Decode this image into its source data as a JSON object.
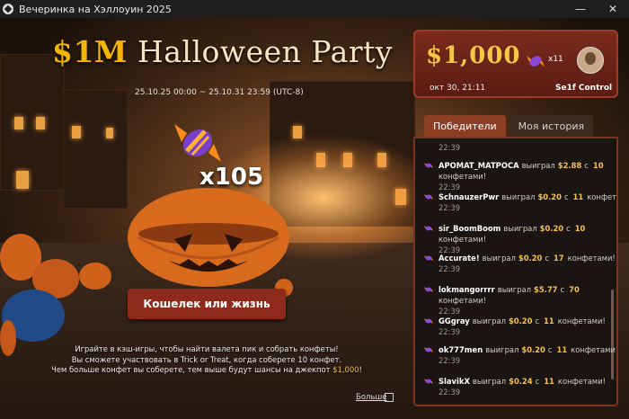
{
  "window": {
    "title": "Вечеринка на Хэллоуин 2025"
  },
  "promo": {
    "title_amount": "$1M",
    "title_text": "Halloween Party",
    "dates": "25.10.25 00:00 ~ 25.10.31 23:59 (UTC-8)",
    "candy_count": "x105",
    "cta_label": "Кошелек или жизнь",
    "desc_line1": "Играйте в кэш-игры, чтобы найти валета пик и собрать конфеты!",
    "desc_line2": "Вы сможете участвовать в Trick or Treat, когда соберете 10 конфет.",
    "desc_line3": "Чем больше конфет вы соберете, тем выше будут шансы на джекпот",
    "desc_jackpot": "$1,000",
    "desc_end": "!",
    "more_link": "Больше"
  },
  "jackpot": {
    "amount": "$1,000",
    "candies": "x11",
    "date": "окт 30, 21:11",
    "player": "Se1f Control"
  },
  "tabs": [
    {
      "label": "Победители",
      "active": true
    },
    {
      "label": "Моя история",
      "active": false
    }
  ],
  "winners": {
    "top_time": "22:39",
    "items": [
      {
        "name": "APOMAT_MATPOCA",
        "won": "выиграл",
        "amount": "$2.88",
        "with": "с",
        "count": "10",
        "unit": "конфетами!",
        "time": "22:39"
      },
      {
        "name": "SchnauzerPwr",
        "won": "выиграл",
        "amount": "$0.20",
        "with": "с",
        "count": "11",
        "unit": "конфетами!",
        "time": "22:39"
      },
      {
        "name": "sir_BoomBoom",
        "won": "выиграл",
        "amount": "$0.20",
        "with": "с",
        "count": "10",
        "unit": "конфетами!",
        "time": "22:39"
      },
      {
        "name": "Accurate!",
        "won": "выиграл",
        "amount": "$0.20",
        "with": "с",
        "count": "17",
        "unit": "конфетами!",
        "time": "22:39"
      },
      {
        "name": "lokmangorrrr",
        "won": "выиграл",
        "amount": "$5.77",
        "with": "с",
        "count": "70",
        "unit": "конфетами!",
        "time": "22:39"
      },
      {
        "name": "GGgray",
        "won": "выиграл",
        "amount": "$0.20",
        "with": "с",
        "count": "11",
        "unit": "конфетами!",
        "time": "22:39"
      },
      {
        "name": "ok777men",
        "won": "выиграл",
        "amount": "$0.20",
        "with": "с",
        "count": "11",
        "unit": "конфетами!",
        "time": "22:39"
      },
      {
        "name": "SlavikX",
        "won": "выиграл",
        "amount": "$0.24",
        "with": "с",
        "count": "11",
        "unit": "конфетами!",
        "time": "22:39"
      }
    ]
  },
  "colors": {
    "accent": "#8e2a1c",
    "gold": "#f4c14b",
    "panel_border": "#7a3520"
  }
}
